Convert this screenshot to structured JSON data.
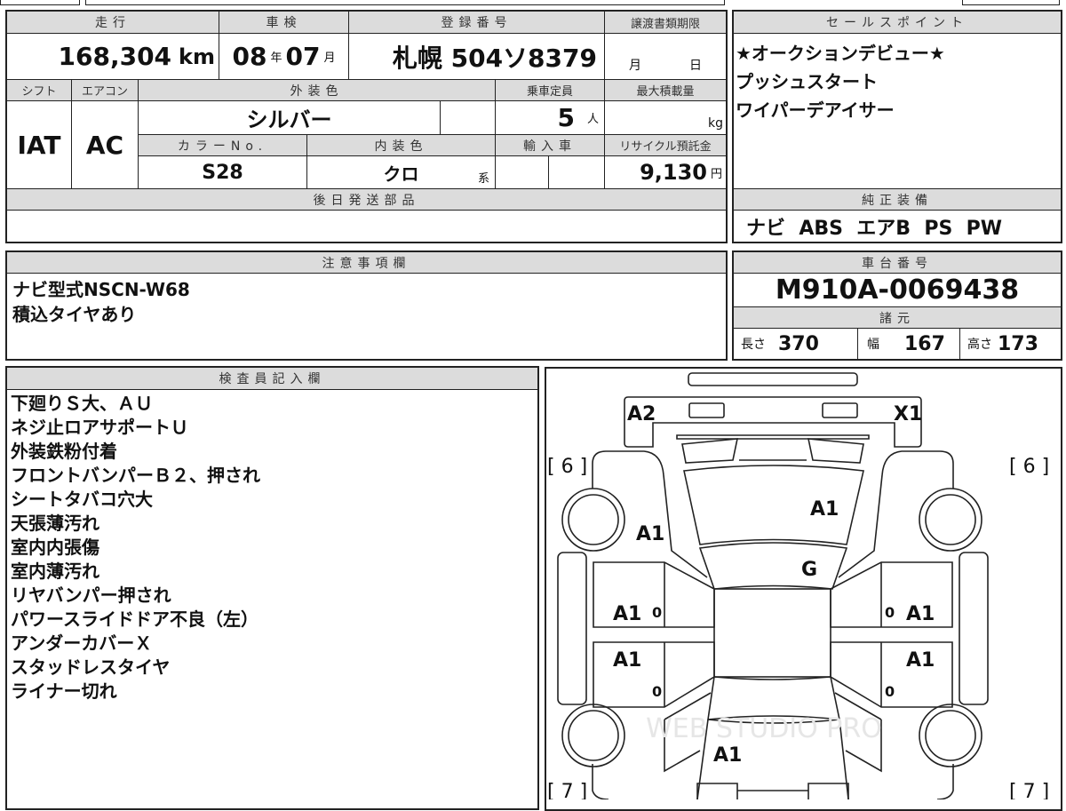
{
  "vehicle_info": {
    "mileage_label": "走行",
    "mileage_value": "168,304",
    "mileage_unit": "km",
    "inspection_label": "車検",
    "inspection_year": "08",
    "inspection_year_unit": "年",
    "inspection_month": "07",
    "inspection_month_unit": "月",
    "registration_label": "登録番号",
    "registration_value": "札幌 504ソ8379",
    "transfer_deadline_label": "譲渡書類期限",
    "transfer_month_unit": "月",
    "transfer_day_unit": "日",
    "shift_label": "シフト",
    "shift_value": "IAT",
    "aircon_label": "エアコン",
    "aircon_value": "AC",
    "exterior_color_label": "外装色",
    "exterior_color_value": "シルバー",
    "capacity_label": "乗車定員",
    "capacity_value": "5",
    "capacity_unit": "人",
    "max_load_label": "最大積載量",
    "max_load_unit": "kg",
    "color_no_label": "カラーNo.",
    "color_no_value": "S28",
    "interior_color_label": "内装色",
    "interior_color_value": "クロ",
    "interior_color_suffix": "系",
    "import_label": "輸入車",
    "recycle_label": "リサイクル預託金",
    "recycle_value": "9,130",
    "recycle_unit": "円",
    "later_parts_label": "後日発送部品"
  },
  "sales_points": {
    "label": "セールスポイント",
    "items": [
      "★オークションデビュー★",
      "プッシュスタート",
      "ワイパーデアイサー"
    ]
  },
  "equipment": {
    "label": "純正装備",
    "value": "ナビ  ABS  エアB  PS  PW"
  },
  "notes": {
    "label": "注意事項欄",
    "items": [
      "ナビ型式NSCN-W68",
      "積込タイヤあり"
    ]
  },
  "chassis": {
    "label": "車台番号",
    "value": "M910A-0069438",
    "specs_label": "諸元",
    "length_label": "長さ",
    "length_value": "370",
    "width_label": "幅",
    "width_value": "167",
    "height_label": "高さ",
    "height_value": "173"
  },
  "inspector": {
    "label": "検査員記入欄",
    "items": [
      "下廻りＳ大、ＡＵ",
      "ネジ止ロアサポートＵ",
      "外装鉄粉付着",
      "フロントバンパーＢ２、押され",
      "シートタバコ穴大",
      "天張薄汚れ",
      "室内内張傷",
      "室内薄汚れ",
      "リヤバンパー押され",
      "パワースライドドア不良（左）",
      "アンダーカバーＸ",
      "スタッドレスタイヤ",
      "ライナー切れ"
    ]
  },
  "diagram": {
    "front_bumper_left": "A2",
    "front_bumper_right": "X1",
    "tire_front_left": "[ 6 ]",
    "tire_front_right": "[ 6 ]",
    "tire_rear_left": "[ 7 ]",
    "tire_rear_right": "[ 7 ]",
    "hood": "A1",
    "left_fender": "A1",
    "windshield": "G",
    "left_front_door": "A1",
    "left_rear_door": "A1",
    "right_front_door": "A1",
    "right_rear_door": "A1",
    "trunk": "A1",
    "zero_mark": "0",
    "watermark": "WEB STUDIO PRO"
  }
}
